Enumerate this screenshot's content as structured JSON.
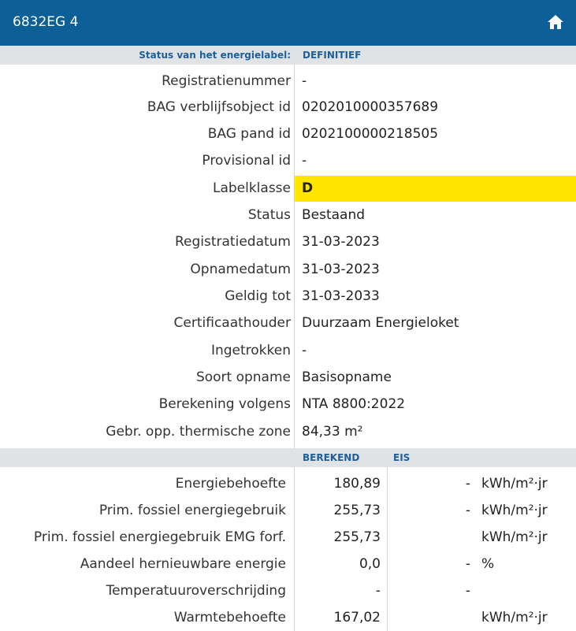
{
  "header": {
    "title": "6832EG 4"
  },
  "status": {
    "label": "Status van het energielabel:",
    "value": "DEFINITIEF"
  },
  "fields": [
    {
      "key": "Registratienummer",
      "value": "-"
    },
    {
      "key": "BAG verblijfsobject id",
      "value": "0202010000357689"
    },
    {
      "key": "BAG pand id",
      "value": "0202100000218505"
    },
    {
      "key": "Provisional id",
      "value": "-"
    },
    {
      "key": "Labelklasse",
      "value": "D"
    },
    {
      "key": "Status",
      "value": "Bestaand"
    },
    {
      "key": "Registratiedatum",
      "value": "31-03-2023"
    },
    {
      "key": "Opnamedatum",
      "value": "31-03-2023"
    },
    {
      "key": "Geldig tot",
      "value": "31-03-2033"
    },
    {
      "key": "Certificaathouder",
      "value": "Duurzaam Energieloket"
    },
    {
      "key": "Ingetrokken",
      "value": "-"
    },
    {
      "key": "Soort opname",
      "value": "Basisopname"
    },
    {
      "key": "Berekening volgens",
      "value": "NTA 8800:2022"
    },
    {
      "key": "Gebr. opp. thermische zone",
      "value": "84,33 m²"
    }
  ],
  "energy": {
    "headers": {
      "calculated": "BEREKEND",
      "requirement": "EIS"
    },
    "rows": [
      {
        "key": "Energiebehoefte",
        "calculated": "180,89",
        "requirement": "-",
        "unit": "kWh/m²·jr"
      },
      {
        "key": "Prim. fossiel energiegebruik",
        "calculated": "255,73",
        "requirement": "-",
        "unit": "kWh/m²·jr"
      },
      {
        "key": "Prim. fossiel energiegebruik EMG forf.",
        "calculated": "255,73",
        "requirement": "",
        "unit": "kWh/m²·jr"
      },
      {
        "key": "Aandeel hernieuwbare energie",
        "calculated": "0,0",
        "requirement": "-",
        "unit": "%"
      },
      {
        "key": "Temperatuuroverschrijding",
        "calculated": "-",
        "requirement": "-",
        "unit": ""
      },
      {
        "key": "Warmtebehoefte",
        "calculated": "167,02",
        "requirement": "",
        "unit": "kWh/m²·jr"
      }
    ]
  },
  "colors": {
    "header": "#0d5f97",
    "bar": "#dfe3e6",
    "label_d": "#ffe500",
    "accent_text": "#1f5f99"
  },
  "icons": {
    "home": "home-icon"
  }
}
